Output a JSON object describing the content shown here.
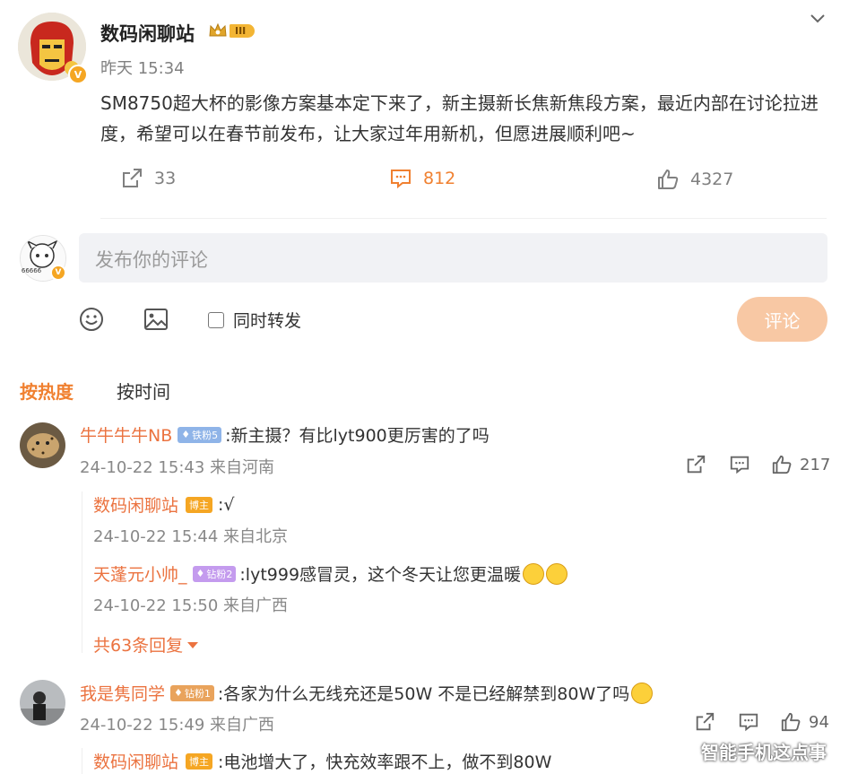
{
  "post": {
    "author": "数码闲聊站",
    "level_badge": "III",
    "verified_badge": "V",
    "time": "昨天 15:34",
    "text": "SM8750超大杯的影像方案基本定下来了，新主摄新长焦新焦段方案，最近内部在讨论拉进度，希望可以在春节前发布，让大家过年用新机，但愿进展顺利吧~",
    "repost_count": "33",
    "comment_count": "812",
    "like_count": "4327"
  },
  "composer": {
    "placeholder": "发布你的评论",
    "repost_label": "同时转发",
    "submit_label": "评论",
    "avatar_caption": "66666"
  },
  "sort": {
    "hot": "按热度",
    "time": "按时间"
  },
  "comments": [
    {
      "user": "牛牛牛牛NB",
      "badge": "铁粉5",
      "text": ":新主摄？有比lyt900更厉害的了吗",
      "meta": "24-10-22 15:43 来自河南",
      "likes": "217",
      "replies": [
        {
          "user": "数码闲聊站",
          "badge": "博主",
          "text": ":√",
          "meta": "24-10-22 15:44 来自北京"
        },
        {
          "user": "天蓬元小帅_",
          "badge": "钻粉2",
          "text": ":lyt999感冒灵，这个冬天让您更温暖",
          "meta": "24-10-22 15:50 来自广西"
        }
      ],
      "more_replies": "共63条回复"
    },
    {
      "user": "我是隽同学",
      "badge": "钻粉1",
      "text": ":各家为什么无线充还是50W 不是已经解禁到80W了吗",
      "meta": "24-10-22 15:49 来自广西",
      "likes": "94",
      "replies": [
        {
          "user": "数码闲聊站",
          "badge": "博主",
          "text": ":电池增大了，快充效率跟不上，做不到80W"
        }
      ]
    }
  ],
  "watermark": "智能手机这点事",
  "colors": {
    "accent": "#f08030",
    "username": "#eb7340",
    "submit_disabled": "#f8c8a4",
    "input_bg": "#f1f2f5"
  },
  "icons": [
    "chevron-down-icon",
    "repost-icon",
    "comment-icon",
    "like-icon",
    "emoji-icon",
    "image-icon",
    "caret-down-icon",
    "crown-icon"
  ]
}
